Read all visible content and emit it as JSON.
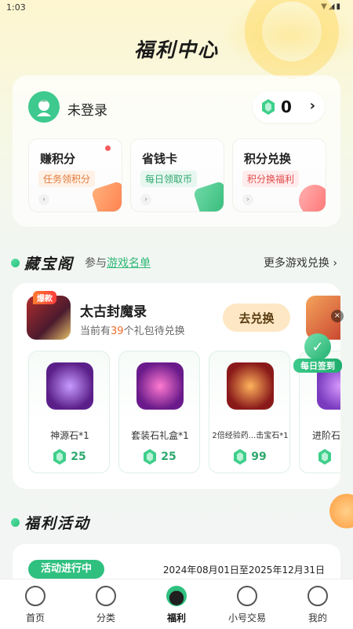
{
  "status_bar": {
    "time": "1:03",
    "icons": [
      "wifi-icon",
      "signal-icon",
      "battery-icon"
    ]
  },
  "page_title": "福利中心",
  "user": {
    "login_text": "未登录",
    "points": "0",
    "points_arrow": "›"
  },
  "features": [
    {
      "title": "赚积分",
      "tag": "任务领积分"
    },
    {
      "title": "省钱卡",
      "tag": "每日领取币"
    },
    {
      "title": "积分兑换",
      "tag": "积分换福利"
    }
  ],
  "treasure": {
    "title": "藏宝阁",
    "sub_prefix": "参与",
    "sub_link": "游戏名单",
    "more": "更多游戏兑换 ›",
    "game": {
      "hot_tag": "爆款",
      "name": "太古封魔录",
      "desc_prefix": "当前有",
      "desc_count": "39",
      "desc_suffix": "个礼包待兑换",
      "button": "去兑换"
    },
    "gifts": [
      {
        "name": "神源石*1",
        "price": "25"
      },
      {
        "name": "套装石礼盒*1",
        "price": "25"
      },
      {
        "name": "2倍经验药...击宝石*1",
        "price": "99"
      },
      {
        "name": "进阶石",
        "price": ""
      }
    ]
  },
  "checkin": {
    "label": "每日签到",
    "close": "×"
  },
  "activity": {
    "title": "福利活动",
    "status": "活动进行中",
    "range": "2024年08月01日至2025年12月31日"
  },
  "nav": [
    {
      "label": "首页",
      "icon": "home-icon"
    },
    {
      "label": "分类",
      "icon": "gamepad-icon"
    },
    {
      "label": "福利",
      "icon": "gift-bag-icon",
      "active": true
    },
    {
      "label": "小号交易",
      "icon": "trade-icon"
    },
    {
      "label": "我的",
      "icon": "profile-icon"
    }
  ],
  "colors": {
    "accent": "#2fc07f",
    "highlight": "#f06b2a"
  }
}
